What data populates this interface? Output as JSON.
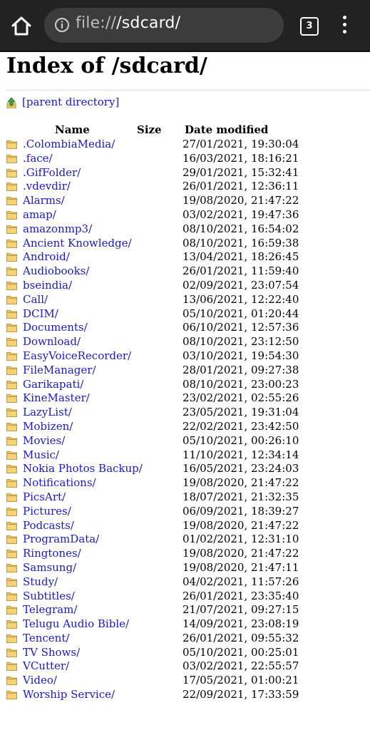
{
  "browser": {
    "url_scheme": "file://",
    "url_path": "/sdcard/",
    "tab_count": "3"
  },
  "page": {
    "title": "Index of /sdcard/",
    "parent_label": "[parent directory]",
    "headers": {
      "name": "Name",
      "size": "Size",
      "date": "Date modified"
    }
  },
  "entries": [
    {
      "name": ".ColombiaMedia/",
      "date": "27/01/2021, 19:30:04"
    },
    {
      "name": ".face/",
      "date": "16/03/2021, 18:16:21"
    },
    {
      "name": ".GifFolder/",
      "date": "29/01/2021, 15:32:41"
    },
    {
      "name": ".vdevdir/",
      "date": "26/01/2021, 12:36:11"
    },
    {
      "name": "Alarms/",
      "date": "19/08/2020, 21:47:22"
    },
    {
      "name": "amap/",
      "date": "03/02/2021, 19:47:36"
    },
    {
      "name": "amazonmp3/",
      "date": "08/10/2021, 16:54:02"
    },
    {
      "name": "Ancient Knowledge/",
      "date": "08/10/2021, 16:59:38"
    },
    {
      "name": "Android/",
      "date": "13/04/2021, 18:26:45"
    },
    {
      "name": "Audiobooks/",
      "date": "26/01/2021, 11:59:40"
    },
    {
      "name": "bseindia/",
      "date": "02/09/2021, 23:07:54"
    },
    {
      "name": "Call/",
      "date": "13/06/2021, 12:22:40"
    },
    {
      "name": "DCIM/",
      "date": "05/10/2021, 01:20:44"
    },
    {
      "name": "Documents/",
      "date": "06/10/2021, 12:57:36"
    },
    {
      "name": "Download/",
      "date": "08/10/2021, 23:12:50"
    },
    {
      "name": "EasyVoiceRecorder/",
      "date": "03/10/2021, 19:54:30"
    },
    {
      "name": "FileManager/",
      "date": "28/01/2021, 09:27:38"
    },
    {
      "name": "Garikapati/",
      "date": "08/10/2021, 23:00:23"
    },
    {
      "name": "KineMaster/",
      "date": "23/02/2021, 02:55:26"
    },
    {
      "name": "LazyList/",
      "date": "23/05/2021, 19:31:04"
    },
    {
      "name": "Mobizen/",
      "date": "22/02/2021, 23:42:50"
    },
    {
      "name": "Movies/",
      "date": "05/10/2021, 00:26:10"
    },
    {
      "name": "Music/",
      "date": "11/10/2021, 12:34:14"
    },
    {
      "name": "Nokia Photos Backup/",
      "date": "16/05/2021, 23:24:03"
    },
    {
      "name": "Notifications/",
      "date": "19/08/2020, 21:47:22"
    },
    {
      "name": "PicsArt/",
      "date": "18/07/2021, 21:32:35"
    },
    {
      "name": "Pictures/",
      "date": "06/09/2021, 18:39:27"
    },
    {
      "name": "Podcasts/",
      "date": "19/08/2020, 21:47:22"
    },
    {
      "name": "ProgramData/",
      "date": "01/02/2021, 12:31:10"
    },
    {
      "name": "Ringtones/",
      "date": "19/08/2020, 21:47:22"
    },
    {
      "name": "Samsung/",
      "date": "19/08/2020, 21:47:11"
    },
    {
      "name": "Study/",
      "date": "04/02/2021, 11:57:26"
    },
    {
      "name": "Subtitles/",
      "date": "26/01/2021, 23:35:40"
    },
    {
      "name": "Telegram/",
      "date": "21/07/2021, 09:27:15"
    },
    {
      "name": "Telugu Audio Bible/",
      "date": "14/09/2021, 23:08:19"
    },
    {
      "name": "Tencent/",
      "date": "26/01/2021, 09:55:32"
    },
    {
      "name": "TV Shows/",
      "date": "05/10/2021, 00:25:01"
    },
    {
      "name": "VCutter/",
      "date": "03/02/2021, 22:55:57"
    },
    {
      "name": "Video/",
      "date": "17/05/2021, 01:00:21"
    },
    {
      "name": "Worship Service/",
      "date": "22/09/2021, 17:33:59"
    }
  ],
  "icons": {
    "folder": "folder-icon",
    "up": "up-arrow-icon"
  },
  "colors": {
    "link": "#1a1acc",
    "toolbar": "#222222",
    "folder": "#e9c46a"
  }
}
